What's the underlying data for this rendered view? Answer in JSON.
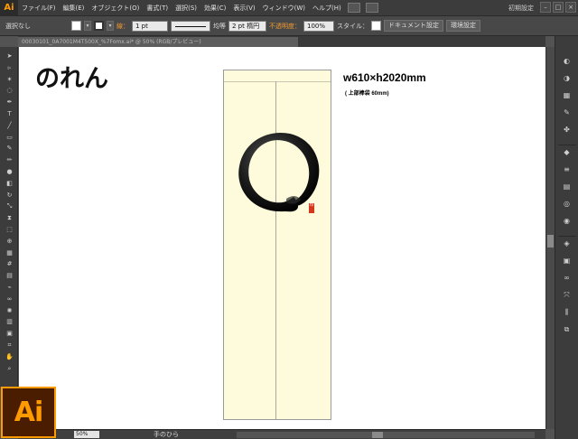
{
  "app": {
    "logo": "Ai",
    "workspace": "初期設定"
  },
  "menu": [
    "ファイル(F)",
    "編集(E)",
    "オブジェクト(O)",
    "書式(T)",
    "選択(S)",
    "効果(C)",
    "表示(V)",
    "ウィンドウ(W)",
    "ヘルプ(H)"
  ],
  "control": {
    "selection": "選択なし",
    "stroke_label": "線：",
    "stroke_weight": "1 pt",
    "stroke_profile": "均等",
    "brush": "2 pt 楕円",
    "opacity_label": "不透明度：",
    "opacity": "100%",
    "style_label": "スタイル：",
    "doc_setup": "ドキュメント設定",
    "preferences": "環境設定"
  },
  "document": {
    "tab": "00030101_0A7001M4T500X_%7Fomx.ai* @ 50% (RGB/プレビュー)"
  },
  "canvas": {
    "title": "のれん",
    "dimension": "w610×h2020mm",
    "note": "( 上部棒袋 60mm)",
    "seal_text": "印"
  },
  "status": {
    "zoom": "50%",
    "tool": "手のひら"
  },
  "colors": {
    "accent": "#ff9a00",
    "artboard": "#fefbdc",
    "ink": "#111111",
    "seal": "#d4371c"
  },
  "icons": {
    "tools": [
      "selection-arrow",
      "direct-selection",
      "magic-wand",
      "lasso",
      "pen",
      "type",
      "line",
      "rectangle",
      "paintbrush",
      "pencil",
      "blob-brush",
      "eraser",
      "rotate",
      "scale",
      "width",
      "free-transform",
      "shape-builder",
      "perspective-grid",
      "mesh",
      "gradient",
      "eyedropper",
      "blend",
      "symbol-sprayer",
      "column-graph",
      "artboard",
      "slice",
      "hand",
      "zoom"
    ],
    "dock": [
      "color",
      "color-guide",
      "swatches",
      "brushes",
      "symbols",
      "graphic-styles",
      "stroke",
      "gradient",
      "transparency",
      "appearance",
      "layers",
      "artboards",
      "links",
      "transform",
      "align",
      "pathfinder"
    ]
  }
}
